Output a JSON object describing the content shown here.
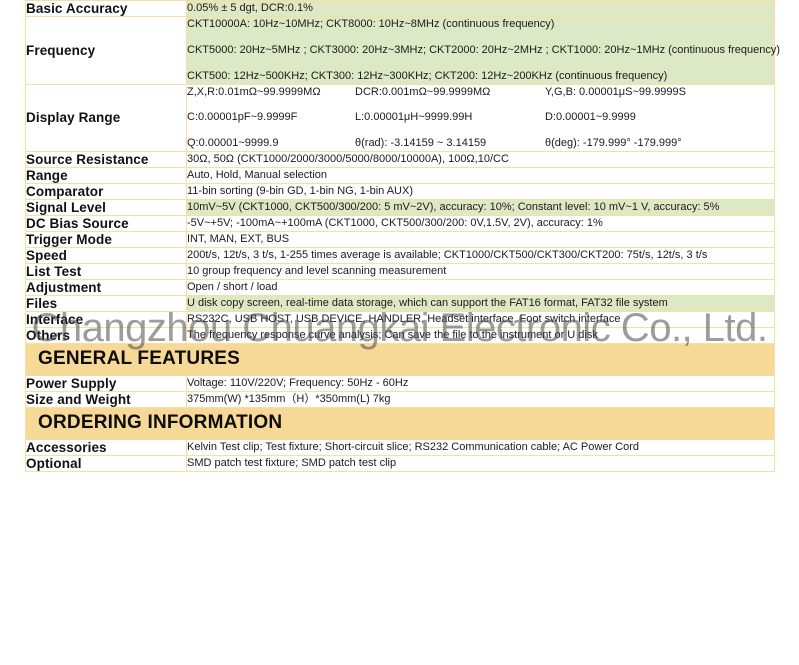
{
  "watermark": "Changzhou Chuangkai Electronic Co., Ltd.",
  "colors": {
    "highlight_green": "#dde8c4",
    "section_band": "#f7d997",
    "border": "#f6dfa0",
    "text": "#1a1a1a"
  },
  "rows": {
    "basic_accuracy": {
      "label": "Basic Accuracy",
      "value": "0.05% ± 5 dgt, DCR:0.1%"
    },
    "frequency": {
      "label": "Frequency",
      "line1": "CKT10000A: 10Hz~10MHz; CKT8000: 10Hz~8MHz (continuous frequency)",
      "line2": "CKT5000: 20Hz~5MHz ; CKT3000: 20Hz~3MHz; CKT2000: 20Hz~2MHz ;  CKT1000: 20Hz~1MHz (continuous frequency)",
      "line3": "CKT500: 12Hz~500KHz; CKT300: 12Hz~300KHz; CKT200: 12Hz~200KHz (continuous frequency)"
    },
    "display_range": {
      "label": "Display Range",
      "r1c1": "Z,X,R:0.01mΩ~99.9999MΩ",
      "r1c2": "DCR:0.001mΩ~99.9999MΩ",
      "r1c3": "Y,G,B: 0.00001μS~99.9999S",
      "r2c1": "C:0.00001pF~9.9999F",
      "r2c2": "L:0.00001μH~9999.99H",
      "r2c3": "D:0.00001~9.9999",
      "r3c1": "Q:0.00001~9999.9",
      "r3c2": "θ(rad): -3.14159 ~ 3.14159",
      "r3c3": "θ(deg): -179.999° -179.999°"
    },
    "source_resistance": {
      "label": "Source Resistance",
      "value": "30Ω, 50Ω (CKT1000/2000/3000/5000/8000/10000A), 100Ω,10/CC"
    },
    "range": {
      "label": "Range",
      "value": "Auto, Hold, Manual selection"
    },
    "comparator": {
      "label": "Comparator",
      "value": "11-bin sorting (9-bin GD, 1-bin NG, 1-bin AUX)"
    },
    "signal_level": {
      "label": "Signal Level",
      "value": "10mV~5V (CKT1000, CKT500/300/200: 5 mV~2V), accuracy: 10%; Constant level: 10 mV~1 V, accuracy: 5%"
    },
    "dc_bias_source": {
      "label": "DC Bias Source",
      "value": "-5V~+5V; -100mA~+100mA (CKT1000, CKT500/300/200: 0V,1.5V, 2V), accuracy: 1%"
    },
    "trigger_mode": {
      "label": "Trigger Mode",
      "value": "INT, MAN, EXT, BUS"
    },
    "speed": {
      "label": "Speed",
      "value": "200t/s, 12t/s, 3 t/s, 1-255 times average is available; CKT1000/CKT500/CKT300/CKT200: 75t/s, 12t/s, 3 t/s"
    },
    "list_test": {
      "label": "List Test",
      "value": "10 group frequency and level scanning measurement"
    },
    "adjustment": {
      "label": "Adjustment",
      "value": "Open / short / load"
    },
    "files": {
      "label": "Files",
      "value": "U disk copy screen, real-time data storage, which can support the FAT16 format, FAT32 file system"
    },
    "interface": {
      "label": "Interface",
      "value": "RS232C, USB HOST, USB DEVICE, HANDLER, Headset interface, Foot switch interface"
    },
    "others": {
      "label": "Others",
      "value": "The frequency response curve analysis; Can save the file to the instrument or U disk"
    },
    "power_supply": {
      "label": "Power Supply",
      "value": "Voltage: 110V/220V; Frequency: 50Hz - 60Hz"
    },
    "size_and_weight": {
      "label": "Size and Weight",
      "value": "375mm(W) *135mm（H）*350mm(L)   7kg"
    },
    "accessories": {
      "label": "Accessories",
      "value": "Kelvin Test clip; Test fixture; Short-circuit slice; RS232 Communication cable; AC Power Cord"
    },
    "optional": {
      "label": "Optional",
      "value": "SMD patch test fixture; SMD patch test clip"
    }
  },
  "sections": {
    "general_features": "GENERAL FEATURES",
    "ordering_information": "ORDERING INFORMATION"
  }
}
